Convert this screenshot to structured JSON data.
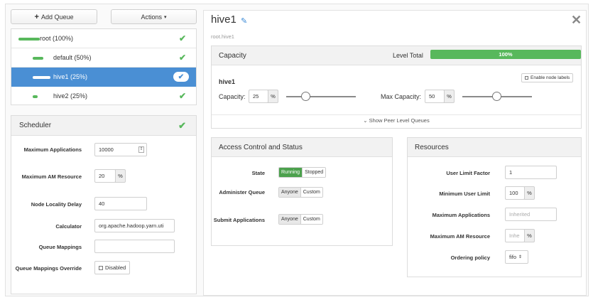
{
  "toolbar": {
    "add_queue_label": "Add Queue",
    "actions_label": "Actions"
  },
  "queues": [
    {
      "label": "root (100%)",
      "selected": false,
      "capacity_fill": 1.0
    },
    {
      "label": "default (50%)",
      "selected": false,
      "capacity_fill": 0.5
    },
    {
      "label": "hive1 (25%)",
      "selected": true,
      "capacity_fill": 0.25
    },
    {
      "label": "hive2 (25%)",
      "selected": false,
      "capacity_fill": 0.25
    }
  ],
  "scheduler": {
    "title": "Scheduler",
    "max_apps_label": "Maximum Applications",
    "max_apps_value": "10000",
    "max_am_label": "Maximum AM Resource",
    "max_am_value": "20",
    "max_am_unit": "%",
    "locality_label": "Node Locality Delay",
    "locality_value": "40",
    "calculator_label": "Calculator",
    "calculator_value": "org.apache.hadoop.yarn.uti",
    "mappings_label": "Queue Mappings",
    "mappings_value": "",
    "override_label": "Queue Mappings Override",
    "override_value": "Disabled"
  },
  "queue": {
    "title": "hive1",
    "path": "root.hive1"
  },
  "capacity": {
    "title": "Capacity",
    "level_total_label": "Level Total",
    "level_total_value": "100%",
    "queue_name": "hive1",
    "enable_node_labels": "Enable node labels",
    "capacity_label": "Capacity:",
    "capacity_value": "25",
    "capacity_unit": "%",
    "capacity_slider_fraction": 0.25,
    "max_capacity_label": "Max Capacity:",
    "max_capacity_value": "50",
    "max_capacity_unit": "%",
    "max_capacity_slider_fraction": 0.5,
    "peer_link": "Show Peer Level Queues"
  },
  "access": {
    "title": "Access Control and Status",
    "state_label": "State",
    "state_options": [
      "Running",
      "Stopped"
    ],
    "state_selected": "Running",
    "administer_label": "Administer Queue",
    "submit_label": "Submit Applications",
    "acl_options": [
      "Anyone",
      "Custom"
    ]
  },
  "resources": {
    "title": "Resources",
    "user_limit_label": "User Limit Factor",
    "user_limit_value": "1",
    "min_user_label": "Minimum User Limit",
    "min_user_value": "100",
    "min_user_unit": "%",
    "max_apps_label": "Maximum Applications",
    "max_apps_placeholder": "Inherited",
    "max_am_label": "Maximum AM Resource",
    "max_am_placeholder": "Inhe",
    "max_am_unit": "%",
    "ordering_label": "Ordering policy",
    "ordering_value": "fifo"
  },
  "colors": {
    "accent": "#4a8fd4",
    "success": "#58b85c"
  }
}
